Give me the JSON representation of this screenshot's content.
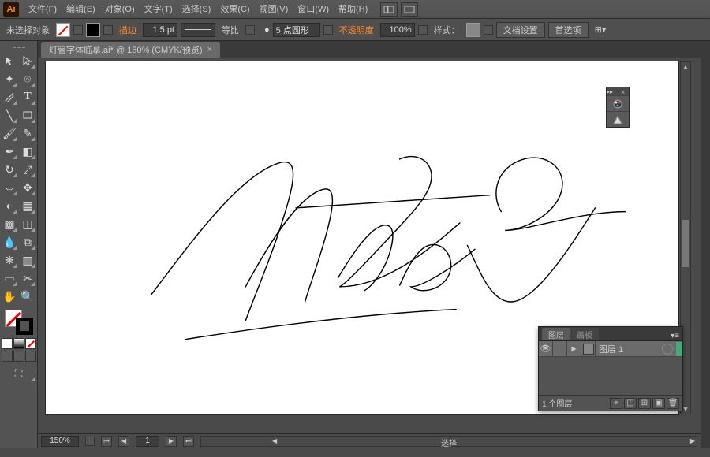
{
  "app": {
    "logo": "Ai"
  },
  "menu": {
    "file": "文件(F)",
    "edit": "编辑(E)",
    "object": "对象(O)",
    "type": "文字(T)",
    "select": "选择(S)",
    "effect": "效果(C)",
    "view": "视图(V)",
    "window": "窗口(W)",
    "help": "帮助(H)"
  },
  "ctrl": {
    "noselection": "未选择对象",
    "stroke_label": "描边",
    "stroke_weight": "1.5 pt",
    "uniform": "等比",
    "pt_round": "5 点圆形",
    "opacity_label": "不透明度",
    "opacity_value": "100%",
    "style_label": "样式：",
    "doc_setup": "文档设置",
    "preferences": "首选项"
  },
  "doc": {
    "tab_title": "灯管字体临摹.ai* @ 150% (CMYK/预览)"
  },
  "status": {
    "zoom": "150%",
    "tool": "选择"
  },
  "layers": {
    "tab_layers": "图层",
    "tab_artboards": "画板",
    "layer1": "图层 1",
    "count": "1 个图层"
  },
  "tools": {
    "selection": "V",
    "direct": "A",
    "wand": "Y",
    "lasso": "Q",
    "pen": "P",
    "type": "T",
    "line": "\\",
    "rect": "M",
    "brush": "B",
    "pencil": "N",
    "blob": "Sh",
    "eraser": "E",
    "rotate": "R",
    "scale": "S",
    "width": "W",
    "warp": "",
    "shapeB": "",
    "perspective": "",
    "mesh": "U",
    "gradient": "G",
    "eyedrop": "I",
    "blend": "",
    "spray": "",
    "graph": "",
    "artboard": "",
    "slice": "",
    "hand": "H",
    "zoom": "Z"
  },
  "float": {
    "p1": "appearance-icon",
    "p2": "graphic-styles-icon"
  }
}
